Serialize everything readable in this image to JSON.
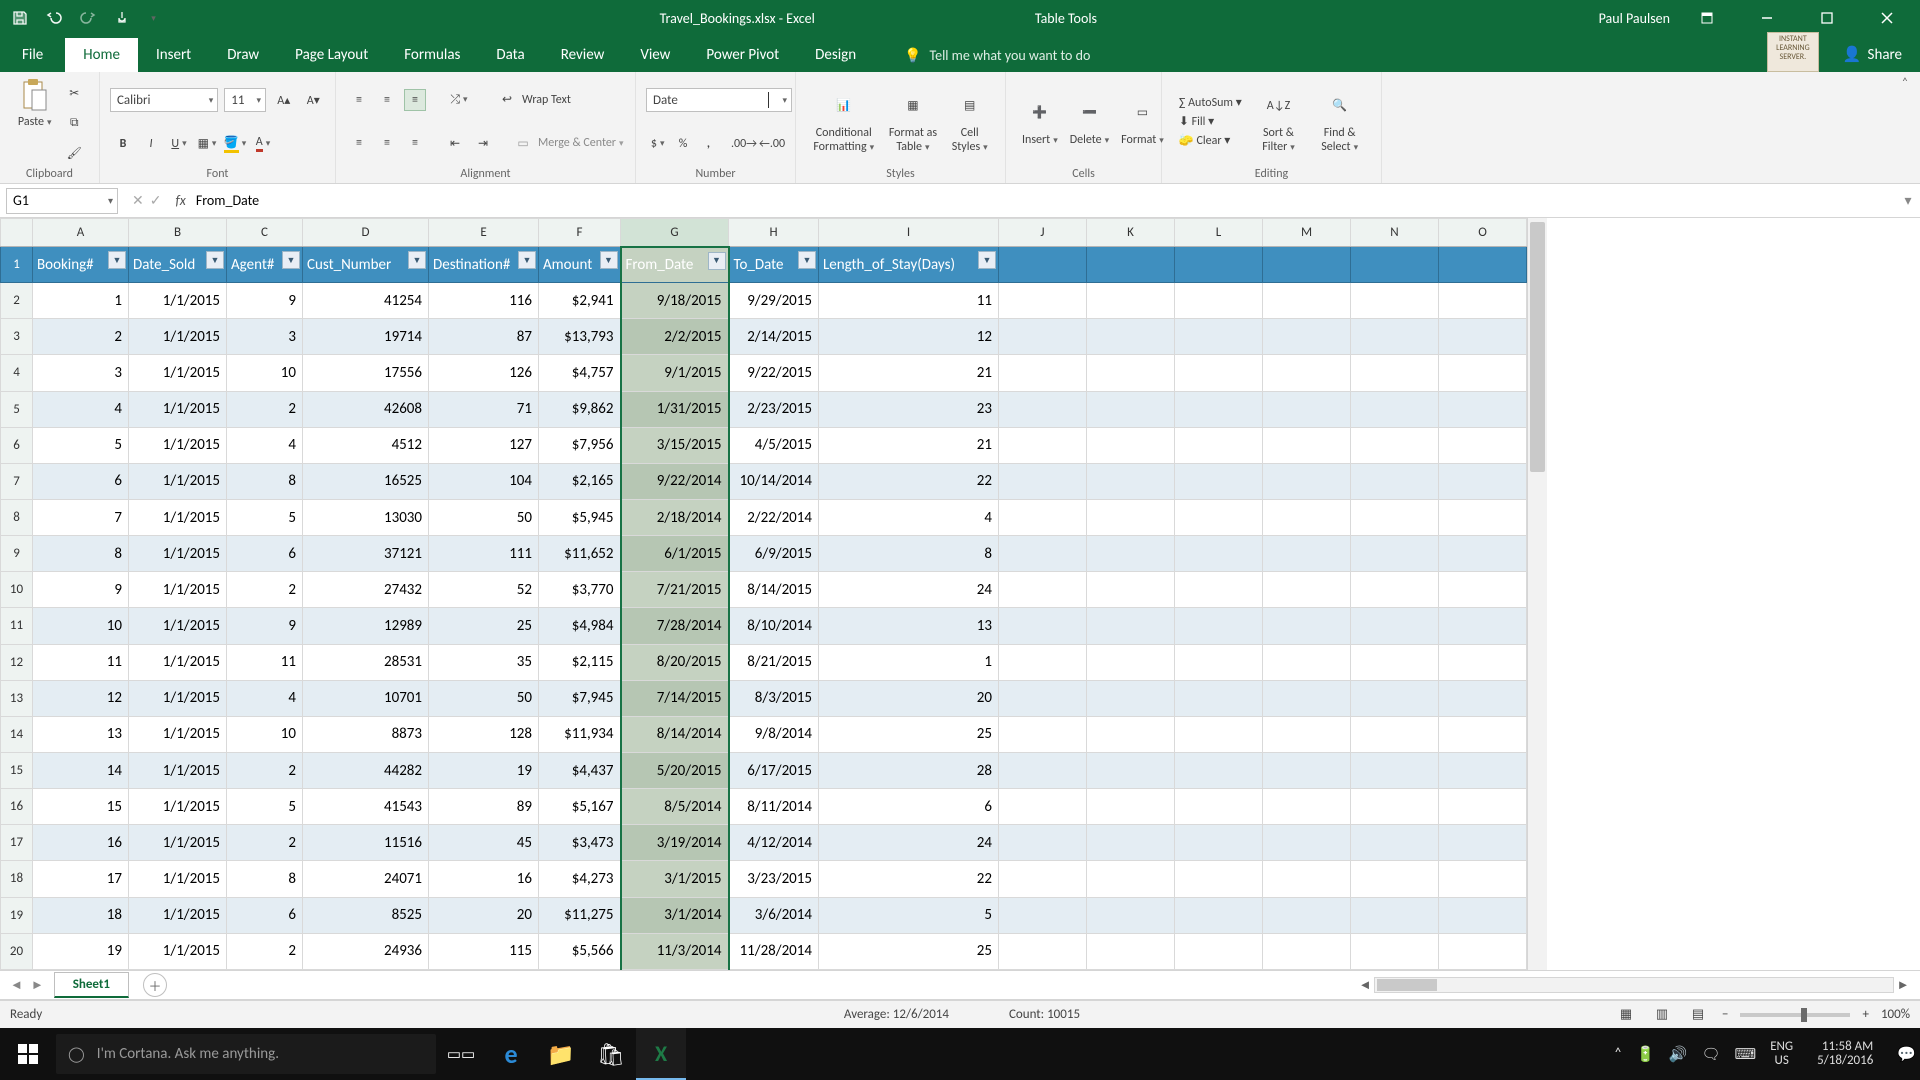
{
  "titlebar": {
    "doc_title": "Travel_Bookings.xlsx - Excel",
    "context_tab": "Table Tools",
    "user": "Paul Paulsen",
    "badge_text": "INSTANT LEARNING SERVER."
  },
  "ribbon_tabs": [
    "File",
    "Home",
    "Insert",
    "Draw",
    "Page Layout",
    "Formulas",
    "Data",
    "Review",
    "View",
    "Power Pivot",
    "Design"
  ],
  "ribbon_active": "Home",
  "tellme": "Tell me what you want to do",
  "share": "Share",
  "ribbon_groups": {
    "clipboard": "Clipboard",
    "paste": "Paste",
    "font": "Font",
    "alignment": "Alignment",
    "wrap": "Wrap Text",
    "merge": "Merge & Center",
    "number": "Number",
    "number_format": "Date",
    "styles": "Styles",
    "cond": "Conditional\nFormatting",
    "fmt_table": "Format as\nTable",
    "cell_styles": "Cell\nStyles",
    "cells": "Cells",
    "insert": "Insert",
    "delete": "Delete",
    "format": "Format",
    "editing": "Editing",
    "autosum": "AutoSum",
    "fill": "Fill",
    "clear": "Clear",
    "sort": "Sort &\nFilter",
    "find": "Find &\nSelect",
    "font_name": "Calibri",
    "font_size": "11"
  },
  "namebox": "G1",
  "formula": "From_Date",
  "columns": [
    "A",
    "B",
    "C",
    "D",
    "E",
    "F",
    "G",
    "H",
    "I",
    "J",
    "K",
    "L",
    "M",
    "N",
    "O"
  ],
  "selected_col": "G",
  "headers": [
    "Booking#",
    "Date_Sold",
    "Agent#",
    "Cust_Number",
    "Destination#",
    "Amount",
    "From_Date",
    "To_Date",
    "Length_of_Stay(Days)"
  ],
  "rows": [
    {
      "n": 2,
      "c": [
        "1",
        "1/1/2015",
        "9",
        "41254",
        "116",
        "$2,941",
        "9/18/2015",
        "9/29/2015",
        "11"
      ]
    },
    {
      "n": 3,
      "c": [
        "2",
        "1/1/2015",
        "3",
        "19714",
        "87",
        "$13,793",
        "2/2/2015",
        "2/14/2015",
        "12"
      ]
    },
    {
      "n": 4,
      "c": [
        "3",
        "1/1/2015",
        "10",
        "17556",
        "126",
        "$4,757",
        "9/1/2015",
        "9/22/2015",
        "21"
      ]
    },
    {
      "n": 5,
      "c": [
        "4",
        "1/1/2015",
        "2",
        "42608",
        "71",
        "$9,862",
        "1/31/2015",
        "2/23/2015",
        "23"
      ]
    },
    {
      "n": 6,
      "c": [
        "5",
        "1/1/2015",
        "4",
        "4512",
        "127",
        "$7,956",
        "3/15/2015",
        "4/5/2015",
        "21"
      ]
    },
    {
      "n": 7,
      "c": [
        "6",
        "1/1/2015",
        "8",
        "16525",
        "104",
        "$2,165",
        "9/22/2014",
        "10/14/2014",
        "22"
      ]
    },
    {
      "n": 8,
      "c": [
        "7",
        "1/1/2015",
        "5",
        "13030",
        "50",
        "$5,945",
        "2/18/2014",
        "2/22/2014",
        "4"
      ]
    },
    {
      "n": 9,
      "c": [
        "8",
        "1/1/2015",
        "6",
        "37121",
        "111",
        "$11,652",
        "6/1/2015",
        "6/9/2015",
        "8"
      ]
    },
    {
      "n": 10,
      "c": [
        "9",
        "1/1/2015",
        "2",
        "27432",
        "52",
        "$3,770",
        "7/21/2015",
        "8/14/2015",
        "24"
      ]
    },
    {
      "n": 11,
      "c": [
        "10",
        "1/1/2015",
        "9",
        "12989",
        "25",
        "$4,984",
        "7/28/2014",
        "8/10/2014",
        "13"
      ]
    },
    {
      "n": 12,
      "c": [
        "11",
        "1/1/2015",
        "11",
        "28531",
        "35",
        "$2,115",
        "8/20/2015",
        "8/21/2015",
        "1"
      ]
    },
    {
      "n": 13,
      "c": [
        "12",
        "1/1/2015",
        "4",
        "10701",
        "50",
        "$7,945",
        "7/14/2015",
        "8/3/2015",
        "20"
      ]
    },
    {
      "n": 14,
      "c": [
        "13",
        "1/1/2015",
        "10",
        "8873",
        "128",
        "$11,934",
        "8/14/2014",
        "9/8/2014",
        "25"
      ]
    },
    {
      "n": 15,
      "c": [
        "14",
        "1/1/2015",
        "2",
        "44282",
        "19",
        "$4,437",
        "5/20/2015",
        "6/17/2015",
        "28"
      ]
    },
    {
      "n": 16,
      "c": [
        "15",
        "1/1/2015",
        "5",
        "41543",
        "89",
        "$5,167",
        "8/5/2014",
        "8/11/2014",
        "6"
      ]
    },
    {
      "n": 17,
      "c": [
        "16",
        "1/1/2015",
        "2",
        "11516",
        "45",
        "$3,473",
        "3/19/2014",
        "4/12/2014",
        "24"
      ]
    },
    {
      "n": 18,
      "c": [
        "17",
        "1/1/2015",
        "8",
        "24071",
        "16",
        "$4,273",
        "3/1/2015",
        "3/23/2015",
        "22"
      ]
    },
    {
      "n": 19,
      "c": [
        "18",
        "1/1/2015",
        "6",
        "8525",
        "20",
        "$11,275",
        "3/1/2014",
        "3/6/2014",
        "5"
      ]
    },
    {
      "n": 20,
      "c": [
        "19",
        "1/1/2015",
        "2",
        "24936",
        "115",
        "$5,566",
        "11/3/2014",
        "11/28/2014",
        "25"
      ]
    }
  ],
  "sheet_tab": "Sheet1",
  "status": {
    "ready": "Ready",
    "avg": "Average: 12/6/2014",
    "count": "Count: 10015",
    "zoom": "100%"
  },
  "taskbar": {
    "cortana": "I'm Cortana. Ask me anything.",
    "lang1": "ENG",
    "lang2": "US",
    "time": "11:58 AM",
    "date": "5/18/2016"
  }
}
